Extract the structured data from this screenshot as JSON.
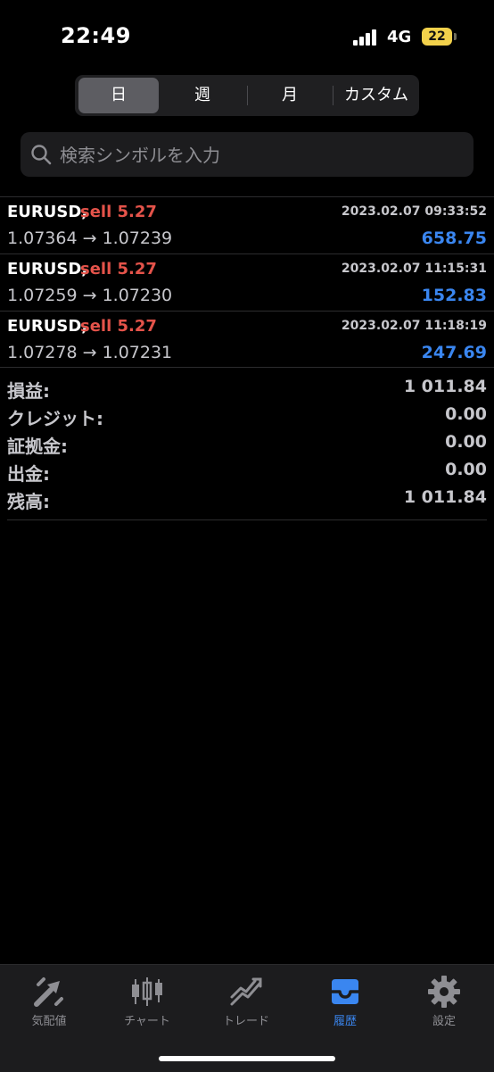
{
  "status": {
    "time": "22:49",
    "network": "4G",
    "battery": "22"
  },
  "segment": {
    "items": [
      "日",
      "週",
      "月",
      "カスタム"
    ],
    "active_index": 0
  },
  "search": {
    "placeholder": "検索シンボルを入力"
  },
  "deals": [
    {
      "symbol": "EURUSD,",
      "side": "sell 5.27",
      "time": "2023.02.07 09:33:52",
      "prices": "1.07364 → 1.07239",
      "profit": "658.75"
    },
    {
      "symbol": "EURUSD,",
      "side": "sell 5.27",
      "time": "2023.02.07 11:15:31",
      "prices": "1.07259 → 1.07230",
      "profit": "152.83"
    },
    {
      "symbol": "EURUSD,",
      "side": "sell 5.27",
      "time": "2023.02.07 11:18:19",
      "prices": "1.07278 → 1.07231",
      "profit": "247.69"
    }
  ],
  "summary": [
    {
      "label": "損益:",
      "value": "1 011.84"
    },
    {
      "label": "クレジット:",
      "value": "0.00"
    },
    {
      "label": "証拠金:",
      "value": "0.00"
    },
    {
      "label": "出金:",
      "value": "0.00"
    },
    {
      "label": "残高:",
      "value": "1 011.84"
    }
  ],
  "tabbar": {
    "items": [
      {
        "label": "気配値",
        "icon": "quotes-icon"
      },
      {
        "label": "チャート",
        "icon": "chart-icon"
      },
      {
        "label": "トレード",
        "icon": "trade-icon"
      },
      {
        "label": "履歴",
        "icon": "history-icon"
      },
      {
        "label": "設定",
        "icon": "settings-icon"
      }
    ],
    "active_index": 3
  },
  "colors": {
    "sell": "#e4534a",
    "profit": "#3a86f0",
    "battery": "#f2d14b",
    "active_tab": "#3a86f0"
  }
}
